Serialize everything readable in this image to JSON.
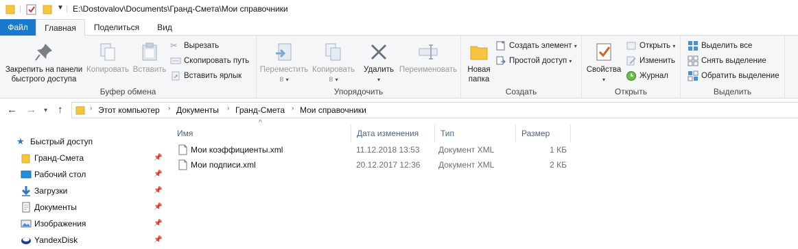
{
  "window": {
    "title": "E:\\Dostovalov\\Documents\\Гранд-Смета\\Мои справочники"
  },
  "ribbon_tabs": [
    "Файл",
    "Главная",
    "Поделиться",
    "Вид"
  ],
  "ribbon": {
    "clipboard": {
      "label": "Буфер обмена",
      "pin": "Закрепить на панели быстрого доступа",
      "pin_line1": "Закрепить на панели",
      "pin_line2": "быстрого доступа",
      "copy": "Копировать",
      "paste": "Вставить",
      "cut": "Вырезать",
      "copy_path": "Скопировать путь",
      "paste_shortcut": "Вставить ярлык"
    },
    "organize": {
      "label": "Упорядочить",
      "move_to": "Переместить",
      "copy_to": "Копировать",
      "to": "в",
      "delete": "Удалить",
      "rename": "Переименовать"
    },
    "new": {
      "label": "Создать",
      "new_folder_line1": "Новая",
      "new_folder_line2": "папка",
      "new_item": "Создать элемент",
      "easy_access": "Простой доступ"
    },
    "open": {
      "label": "Открыть",
      "properties": "Свойства",
      "open": "Открыть",
      "edit": "Изменить",
      "history": "Журнал"
    },
    "select": {
      "label": "Выделить",
      "select_all": "Выделить все",
      "select_none": "Снять выделение",
      "invert": "Обратить выделение"
    }
  },
  "breadcrumb": [
    "Этот компьютер",
    "Документы",
    "Гранд-Смета",
    "Мои справочники"
  ],
  "nav_pane": {
    "quick_access": "Быстрый доступ",
    "items": [
      {
        "label": "Гранд-Смета",
        "icon": "folder-icon"
      },
      {
        "label": "Рабочий стол",
        "icon": "desktop-icon"
      },
      {
        "label": "Загрузки",
        "icon": "downloads-icon"
      },
      {
        "label": "Документы",
        "icon": "documents-icon"
      },
      {
        "label": "Изображения",
        "icon": "pictures-icon"
      },
      {
        "label": "YandexDisk",
        "icon": "yandexdisk-icon"
      }
    ]
  },
  "file_list": {
    "columns": [
      "Имя",
      "Дата изменения",
      "Тип",
      "Размер"
    ],
    "rows": [
      {
        "name": "Мои коэффициенты.xml",
        "date": "11.12.2018 13:53",
        "type": "Документ XML",
        "size": "1 КБ"
      },
      {
        "name": "Мои подписи.xml",
        "date": "20.12.2017 12:36",
        "type": "Документ XML",
        "size": "2 КБ"
      }
    ]
  },
  "colors": {
    "file_tab": "#1979ca",
    "ribbon_bg": "#f5f6f7",
    "column_header_text": "#4d6082",
    "folder_yellow": "#f5c542"
  }
}
